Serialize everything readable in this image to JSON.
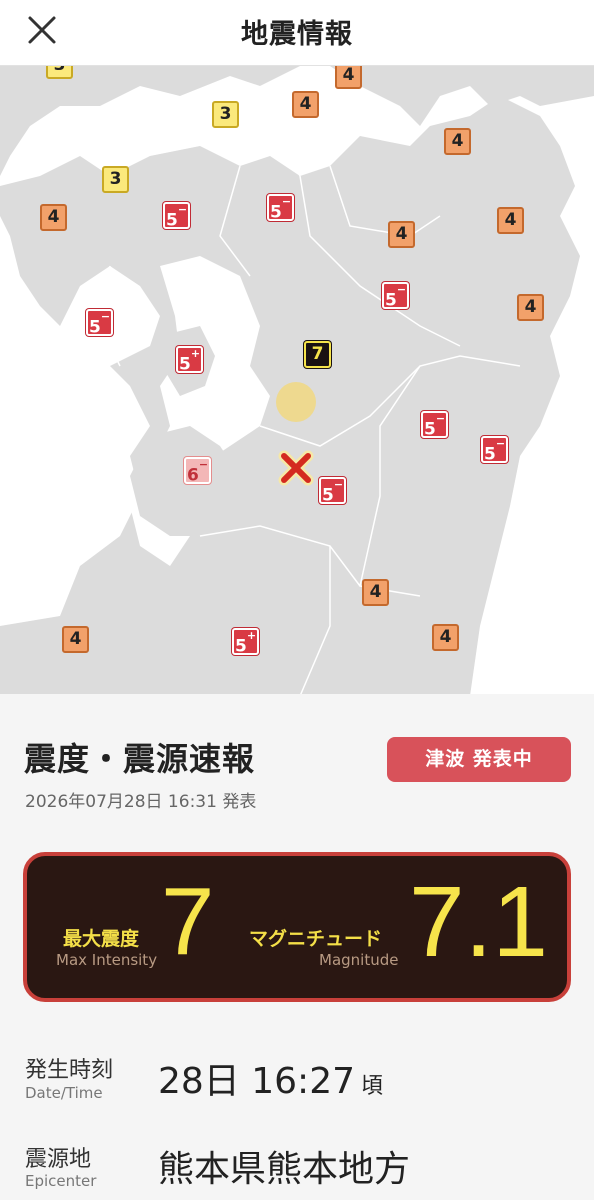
{
  "header": {
    "title": "地震情報",
    "close_icon": "close-icon"
  },
  "map": {
    "epicenter_icon": "epicenter-x-icon",
    "badges": [
      {
        "label": "4",
        "level": "4"
      },
      {
        "label": "3",
        "level": "3"
      },
      {
        "label": "4",
        "level": "4"
      },
      {
        "label": "4",
        "level": "4"
      },
      {
        "label": "3",
        "level": "3"
      },
      {
        "label": "4",
        "level": "4"
      },
      {
        "label": "5",
        "sub": "−",
        "level": "5-"
      },
      {
        "label": "5",
        "sub": "−",
        "level": "5-"
      },
      {
        "label": "4",
        "level": "4"
      },
      {
        "label": "4",
        "level": "4"
      },
      {
        "label": "5",
        "sub": "−",
        "level": "5-"
      },
      {
        "label": "4",
        "level": "4"
      },
      {
        "label": "5",
        "sub": "−",
        "level": "5-"
      },
      {
        "label": "5",
        "sub": "+",
        "level": "5+"
      },
      {
        "label": "7",
        "level": "7"
      },
      {
        "label": "5",
        "sub": "−",
        "level": "5-"
      },
      {
        "label": "5",
        "sub": "−",
        "level": "5-"
      },
      {
        "label": "6",
        "sub": "−",
        "level": "6-"
      },
      {
        "label": "5",
        "sub": "−",
        "level": "5-"
      },
      {
        "label": "4",
        "level": "4"
      },
      {
        "label": "4",
        "level": "4"
      },
      {
        "label": "5",
        "sub": "+",
        "level": "5+"
      },
      {
        "label": "4",
        "level": "4"
      }
    ]
  },
  "report": {
    "title": "震度・震源速報",
    "issued": "2026年07月28日 16:31 発表",
    "tsunami_label": "津波 発表中"
  },
  "summary": {
    "max_intensity_jp": "最大震度",
    "max_intensity_en": "Max Intensity",
    "max_intensity_value": "7",
    "magnitude_jp": "マグニチュード",
    "magnitude_en": "Magnitude",
    "magnitude_value": "7.1"
  },
  "details": {
    "datetime_label_jp": "発生時刻",
    "datetime_label_en": "Date/Time",
    "datetime_value": "28日 16:27",
    "datetime_suffix": "頃",
    "epicenter_label_jp": "震源地",
    "epicenter_label_en": "Epicenter",
    "epicenter_value": "熊本県熊本地方"
  },
  "colors": {
    "intensity_3": "#fbe97c",
    "intensity_4": "#f2a16a",
    "intensity_5": "#d93a44",
    "intensity_6": "#f3b7b7",
    "intensity_7": "#1a1212",
    "tsunami": "#d8525a",
    "card_bg": "#2a1712",
    "accent_yellow": "#f6e44b"
  }
}
